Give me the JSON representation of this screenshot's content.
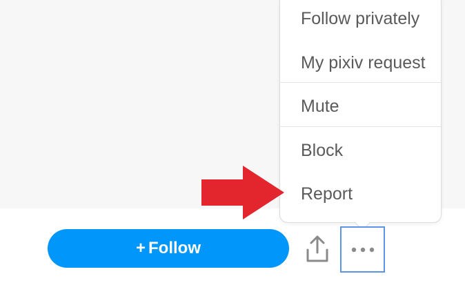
{
  "menu": {
    "items": [
      {
        "label": "Follow privately"
      },
      {
        "label": "My pixiv request"
      },
      {
        "label": "Mute"
      },
      {
        "label": "Block"
      },
      {
        "label": "Report"
      }
    ]
  },
  "actions": {
    "follow_plus": "+",
    "follow_label": "Follow",
    "share_icon": "share-icon",
    "more_icon": "ellipsis-icon"
  },
  "colors": {
    "follow_button": "#0096fa",
    "arrow": "#e3262d",
    "more_button_border": "#5a93e8",
    "menu_text": "#5a5a5a"
  }
}
